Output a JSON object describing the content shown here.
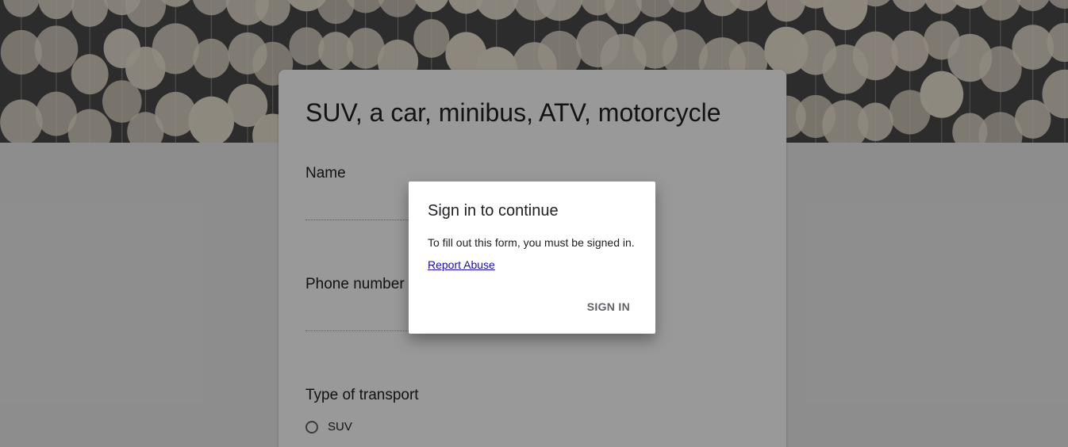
{
  "form": {
    "title": "SUV, a car, minibus, ATV, motorcycle",
    "questions": [
      {
        "label": "Name",
        "type": "short-answer"
      },
      {
        "label": "Phone number",
        "type": "short-answer"
      },
      {
        "label": "Type of transport",
        "type": "radio",
        "options": [
          "SUV"
        ]
      }
    ]
  },
  "dialog": {
    "title": "Sign in to continue",
    "message": "To fill out this form, you must be signed in.",
    "link_label": "Report Abuse",
    "button_label": "SIGN IN"
  },
  "colors": {
    "header_background": "#4a4a4a",
    "decor_circles": "#efe6d6",
    "link": "#1a0dab",
    "button_text": "#5f6368"
  },
  "icons": {
    "header": "hanging-paper-circles-image",
    "radio": "radio-unchecked-icon"
  }
}
